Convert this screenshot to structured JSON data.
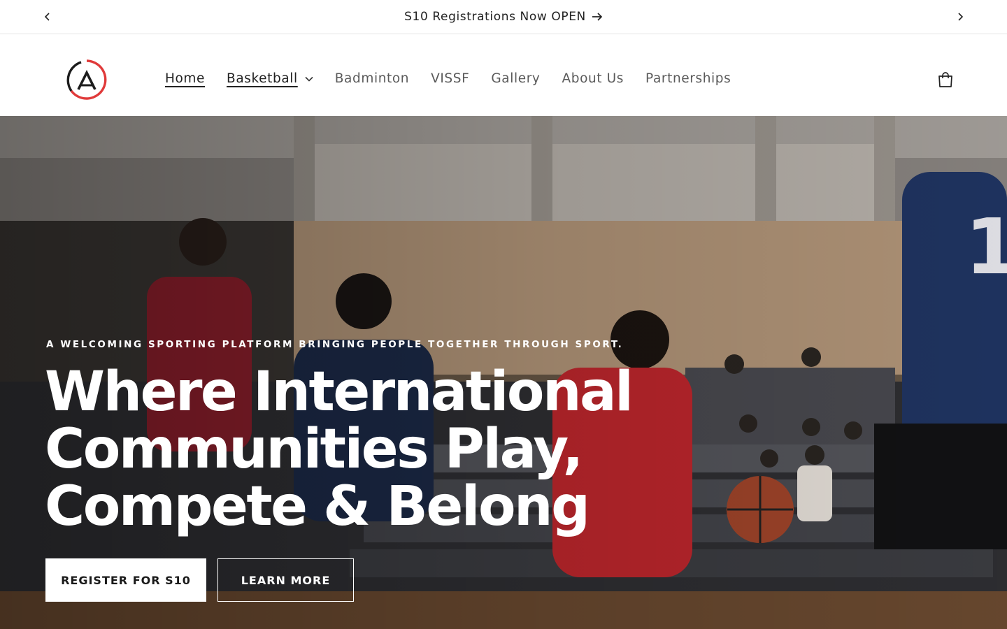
{
  "announcement": {
    "text": "S10 Registrations Now OPEN",
    "prev_icon": "chevron-left-icon",
    "next_icon": "chevron-right-icon",
    "arrow_icon": "arrow-right-icon"
  },
  "header": {
    "logo_icon": "brand-logo-icon",
    "nav": [
      {
        "label": "Home",
        "active": true
      },
      {
        "label": "Basketball",
        "has_dropdown": true
      },
      {
        "label": "Badminton"
      },
      {
        "label": "VISSF"
      },
      {
        "label": "Gallery"
      },
      {
        "label": "About Us"
      },
      {
        "label": "Partnerships"
      }
    ],
    "cart_icon": "shopping-bag-icon"
  },
  "hero": {
    "eyebrow": "A WELCOMING SPORTING PLATFORM BRINGING PEOPLE TOGETHER THROUGH SPORT.",
    "headline_line1": "Where International",
    "headline_line2": "Communities Play,",
    "headline_line3": "Compete & Belong",
    "primary_button": "REGISTER FOR S10",
    "secondary_button": "LEARN MORE"
  },
  "colors": {
    "brand_red": "#e03a3a",
    "text_dark": "#222222",
    "nav_gray": "#5a5a5a"
  }
}
